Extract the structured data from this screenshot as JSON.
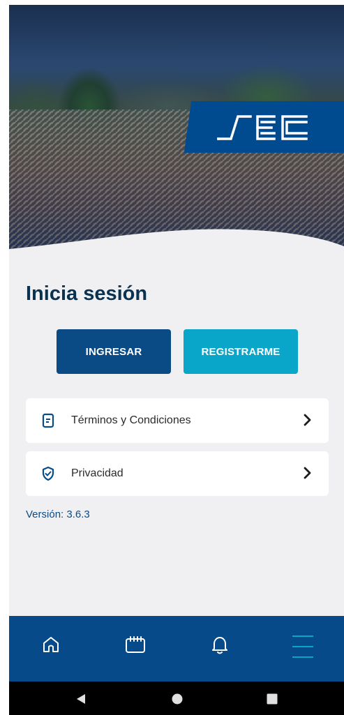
{
  "brand": {
    "logo_text": "SEC",
    "primary_color": "#0a4b86",
    "secondary_color": "#0aa6c9"
  },
  "login": {
    "title": "Inicia sesión",
    "ingresar_label": "INGRESAR",
    "registrarme_label": "REGISTRARME"
  },
  "menu_items": [
    {
      "label": "Términos y Condiciones",
      "icon": "document-icon"
    },
    {
      "label": "Privacidad",
      "icon": "shield-check-icon"
    }
  ],
  "version_text": "Versión: 3.6.3",
  "bottom_nav": [
    {
      "name": "home",
      "icon": "home-icon"
    },
    {
      "name": "calendar",
      "icon": "calendar-icon"
    },
    {
      "name": "notifications",
      "icon": "bell-icon"
    },
    {
      "name": "menu",
      "icon": "menu-icon",
      "active": true
    }
  ],
  "system_nav": [
    "back",
    "home",
    "recents"
  ]
}
